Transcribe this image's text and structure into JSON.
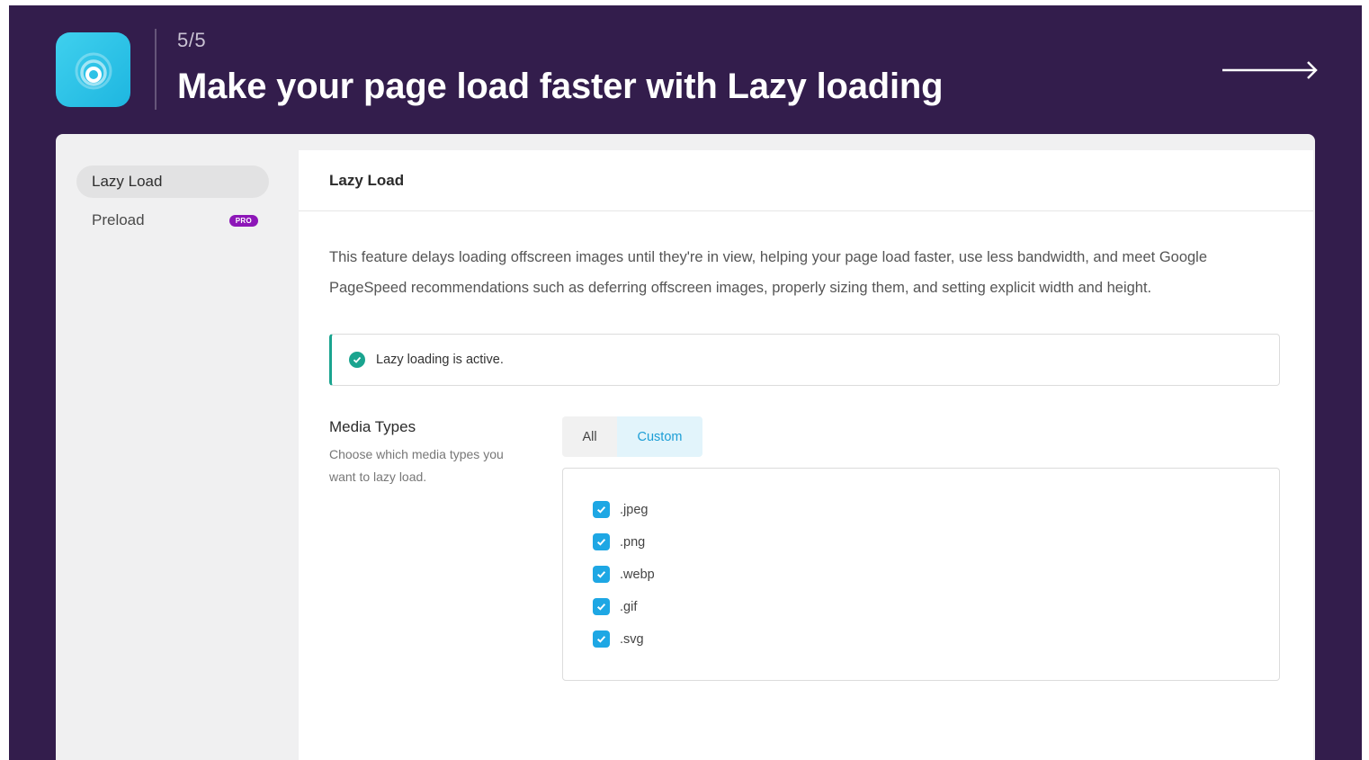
{
  "header": {
    "step": "5/5",
    "headline": "Make your page load faster with Lazy loading"
  },
  "sidebar": {
    "items": [
      {
        "label": "Lazy Load",
        "active": true
      },
      {
        "label": "Preload",
        "badge": "PRO"
      }
    ]
  },
  "content": {
    "title": "Lazy Load",
    "description": "This feature delays loading offscreen images until they're in view, helping your page load faster, use less bandwidth, and meet Google PageSpeed recommendations such as deferring offscreen images, properly sizing them, and setting explicit width and height.",
    "notice": "Lazy loading is active.",
    "media_types": {
      "title": "Media Types",
      "description": "Choose which media types you want to lazy load.",
      "tabs": [
        "All",
        "Custom"
      ],
      "selected_tab": "Custom",
      "options": [
        {
          "label": ".jpeg",
          "checked": true
        },
        {
          "label": ".png",
          "checked": true
        },
        {
          "label": ".webp",
          "checked": true
        },
        {
          "label": ".gif",
          "checked": true
        },
        {
          "label": ".svg",
          "checked": true
        }
      ]
    }
  },
  "colors": {
    "frame_bg": "#331d4c",
    "logo_accent": "#3fd0ee",
    "pro_badge": "#8d16b8",
    "success": "#1aa48f",
    "checkbox": "#1ea7e4",
    "tab_active_text": "#1c9ed6"
  },
  "icons": [
    "broadcast-logo-icon",
    "arrow-right-icon",
    "check-circle-icon",
    "checkbox-checked-icon"
  ]
}
